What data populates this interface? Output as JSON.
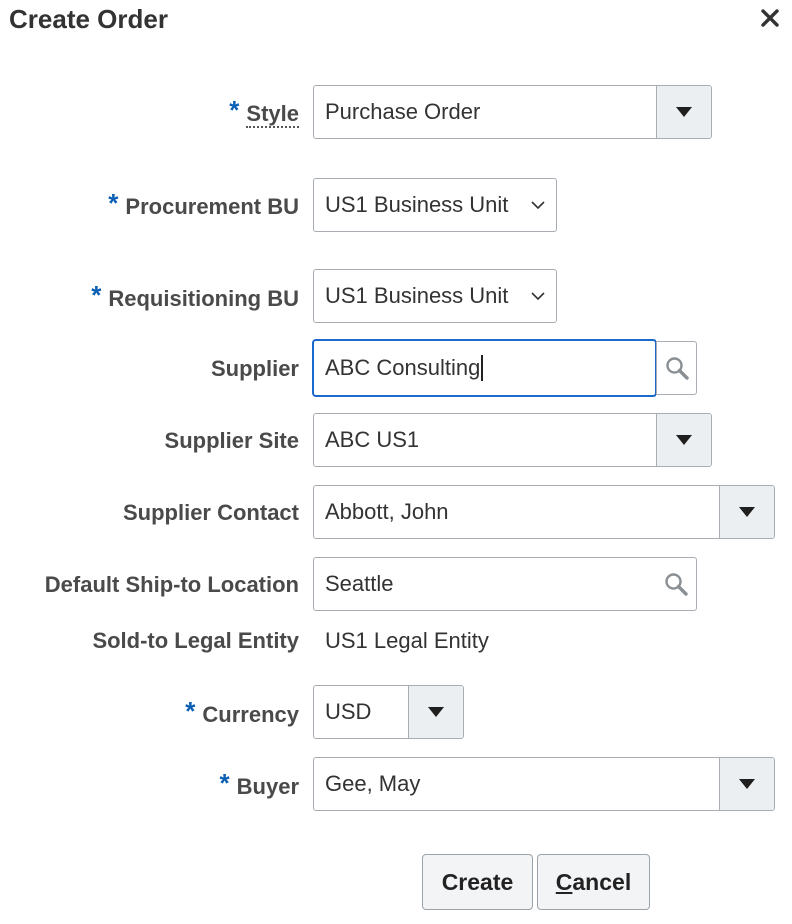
{
  "dialog": {
    "title": "Create Order",
    "close_icon": "close-icon"
  },
  "colors": {
    "required": "#0a5fb4",
    "focus": "#1a6acb",
    "dropdown_button_bg": "#eceff1"
  },
  "required_marker": "*",
  "fields": {
    "style": {
      "label": "Style",
      "value": "Purchase Order",
      "required": true
    },
    "procurement_bu": {
      "label": "Procurement BU",
      "value": "US1 Business Unit",
      "required": true
    },
    "requisitioning_bu": {
      "label": "Requisitioning BU",
      "value": "US1 Business Unit",
      "required": true
    },
    "supplier": {
      "label": "Supplier",
      "value": "ABC Consulting",
      "focused": true
    },
    "supplier_site": {
      "label": "Supplier Site",
      "value": "ABC US1"
    },
    "supplier_contact": {
      "label": "Supplier Contact",
      "value": "Abbott, John"
    },
    "ship_to": {
      "label": "Default Ship-to Location",
      "value": "Seattle"
    },
    "sold_to": {
      "label": "Sold-to Legal Entity",
      "value": "US1 Legal Entity"
    },
    "currency": {
      "label": "Currency",
      "value": "USD",
      "required": true
    },
    "buyer": {
      "label": "Buyer",
      "value": "Gee, May",
      "required": true
    }
  },
  "buttons": {
    "create": "Create",
    "cancel_mnemonic": "C",
    "cancel_rest": "ancel"
  }
}
